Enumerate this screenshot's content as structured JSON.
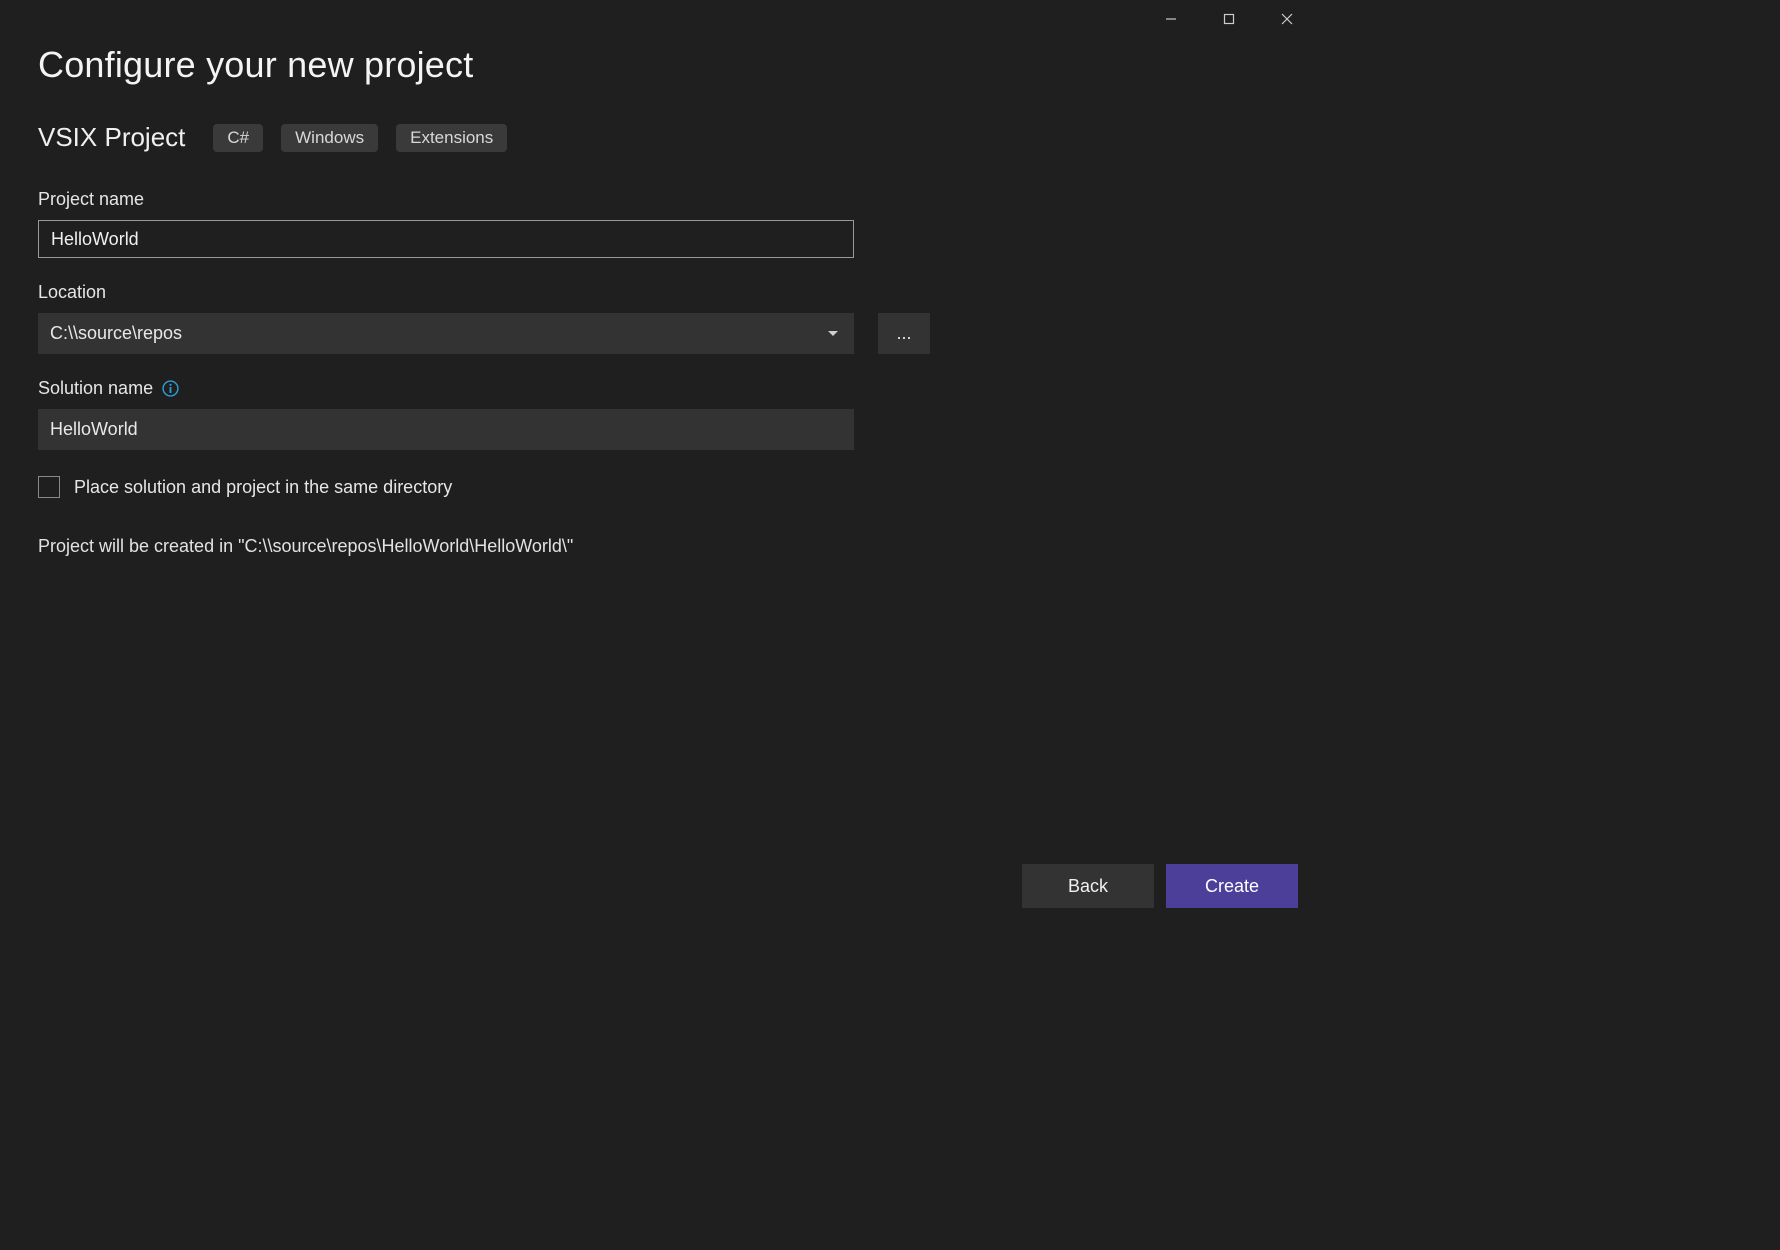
{
  "page": {
    "title": "Configure your new project"
  },
  "template": {
    "name": "VSIX Project",
    "tags": [
      "C#",
      "Windows",
      "Extensions"
    ]
  },
  "fields": {
    "project_name_label": "Project name",
    "project_name_value": "HelloWorld",
    "location_label": "Location",
    "location_value": "C:\\\\source\\repos",
    "browse_label": "...",
    "solution_name_label": "Solution name",
    "solution_name_value": "HelloWorld",
    "same_dir_label": "Place solution and project in the same directory",
    "same_dir_checked": false
  },
  "summary": {
    "text": "Project will be created in \"C:\\\\source\\repos\\HelloWorld\\HelloWorld\\\""
  },
  "footer": {
    "back_label": "Back",
    "create_label": "Create"
  },
  "icons": {
    "info": "info-icon",
    "caret": "chevron-down-icon"
  }
}
